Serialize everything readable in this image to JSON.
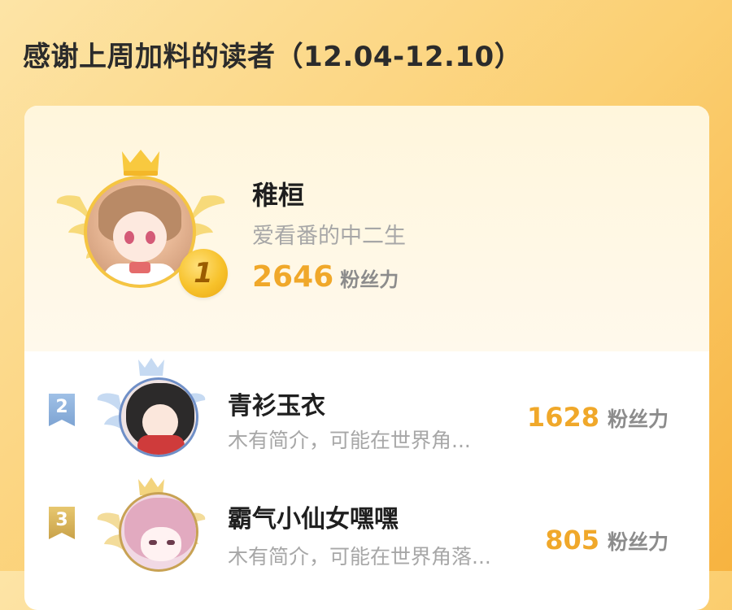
{
  "page": {
    "title": "感谢上周加料的读者（12.04-12.10）"
  },
  "leaderboard": {
    "first": {
      "rank": "1",
      "name": "稚桓",
      "bio": "爱看番的中二生",
      "score": "2646",
      "score_unit": "粉丝力"
    },
    "rows": [
      {
        "rank": "2",
        "name": "青衫玉衣",
        "bio": "木有简介，可能在世界角...",
        "score": "1628",
        "score_unit": "粉丝力"
      },
      {
        "rank": "3",
        "name": "霸气小仙女嘿嘿",
        "bio": "木有简介，可能在世界角落...",
        "score": "805",
        "score_unit": "粉丝力"
      }
    ]
  },
  "colors": {
    "gold": "#f0a82a",
    "rank2_blue": "#7ea4d3",
    "rank3_gold": "#c9a24a",
    "muted_text": "#a7a7a7"
  },
  "icons": [
    "crown-icon",
    "wings-icon",
    "rank-ribbon-icon"
  ]
}
